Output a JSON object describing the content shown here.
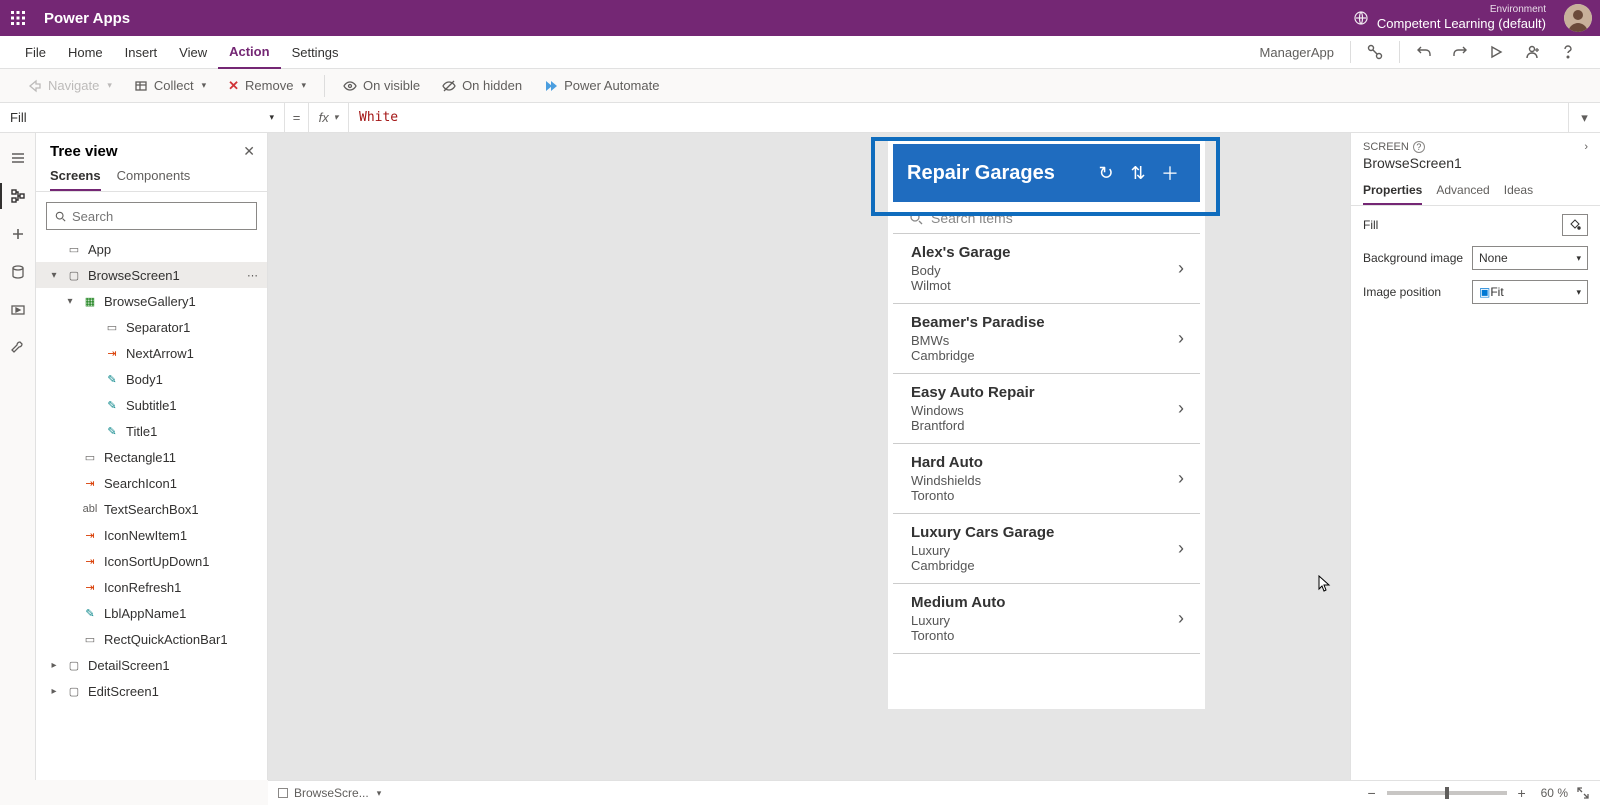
{
  "topbar": {
    "brand": "Power Apps",
    "env_label": "Environment",
    "env_value": "Competent Learning (default)"
  },
  "menubar": {
    "items": [
      "File",
      "Home",
      "Insert",
      "View",
      "Action",
      "Settings"
    ],
    "active_index": 4,
    "appname": "ManagerApp"
  },
  "ribbon": {
    "navigate": "Navigate",
    "collect": "Collect",
    "remove": "Remove",
    "onvisible": "On visible",
    "onhidden": "On hidden",
    "powerautomate": "Power Automate"
  },
  "fxbar": {
    "property": "Fill",
    "value": "White"
  },
  "treepanel": {
    "title": "Tree view",
    "tabs": [
      "Screens",
      "Components"
    ],
    "search_placeholder": "Search",
    "nodes": {
      "app": "App",
      "browse": "BrowseScreen1",
      "gallery": "BrowseGallery1",
      "children": [
        "Separator1",
        "NextArrow1",
        "Body1",
        "Subtitle1",
        "Title1"
      ],
      "screen_children": [
        "Rectangle11",
        "SearchIcon1",
        "TextSearchBox1",
        "IconNewItem1",
        "IconSortUpDown1",
        "IconRefresh1",
        "LblAppName1",
        "RectQuickActionBar1"
      ],
      "detail": "DetailScreen1",
      "edit": "EditScreen1"
    }
  },
  "app_preview": {
    "title": "Repair Garages",
    "search_placeholder": "Search items",
    "items": [
      {
        "name": "Alex's Garage",
        "line2": "Body",
        "line3": "Wilmot"
      },
      {
        "name": "Beamer's Paradise",
        "line2": "BMWs",
        "line3": "Cambridge"
      },
      {
        "name": "Easy Auto Repair",
        "line2": "Windows",
        "line3": "Brantford"
      },
      {
        "name": "Hard Auto",
        "line2": "Windshields",
        "line3": "Toronto"
      },
      {
        "name": "Luxury Cars Garage",
        "line2": "Luxury",
        "line3": "Cambridge"
      },
      {
        "name": "Medium Auto",
        "line2": "Luxury",
        "line3": "Toronto"
      }
    ]
  },
  "rpanel": {
    "section": "SCREEN",
    "name": "BrowseScreen1",
    "tabs": [
      "Properties",
      "Advanced",
      "Ideas"
    ],
    "props": {
      "fill_label": "Fill",
      "bgimg_label": "Background image",
      "bgimg_value": "None",
      "imgpos_label": "Image position",
      "imgpos_value": "Fit"
    }
  },
  "statusbar": {
    "crumb": "BrowseScre...",
    "zoom": "60",
    "pct": "%"
  }
}
